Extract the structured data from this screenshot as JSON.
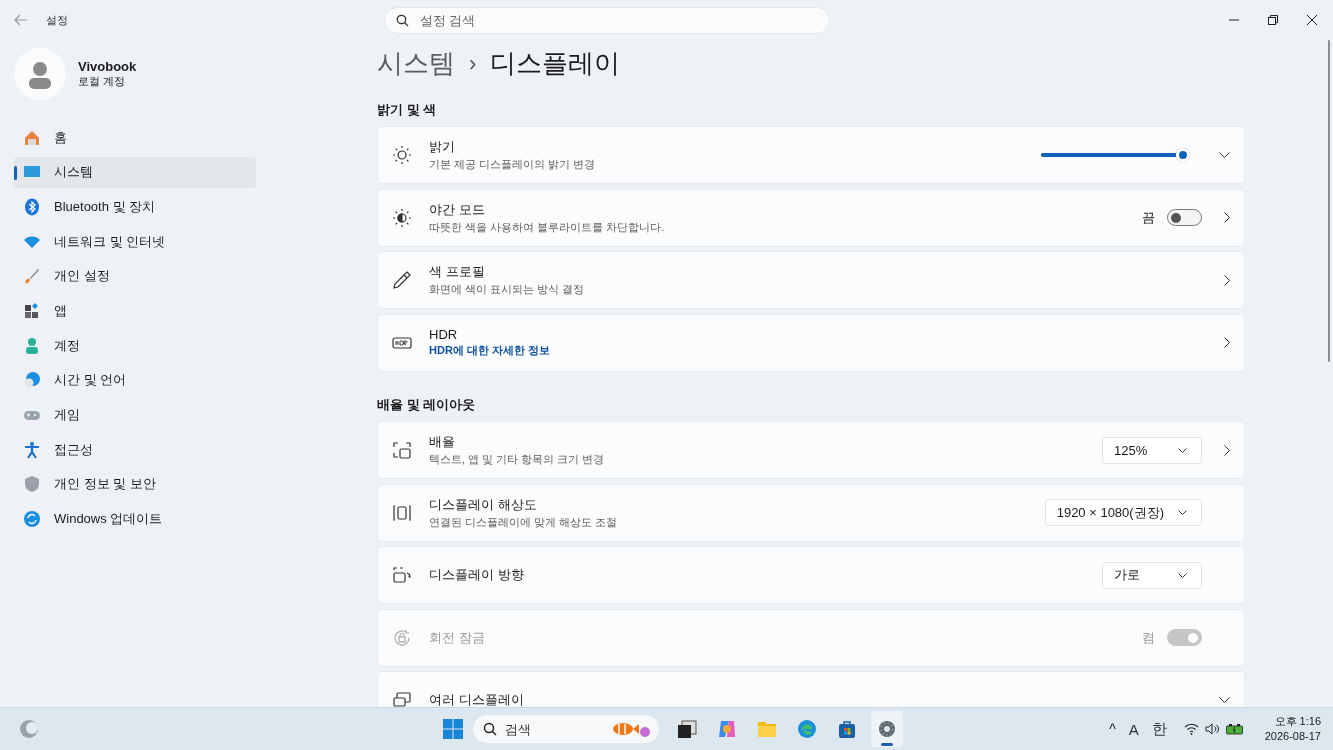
{
  "window": {
    "title": "설정",
    "search": {
      "placeholder": "설정 검색"
    }
  },
  "profile": {
    "name": "Vivobook",
    "account": "로컬 계정"
  },
  "nav": [
    {
      "label": "홈",
      "selected": false
    },
    {
      "label": "시스템",
      "selected": true
    },
    {
      "label": "Bluetooth 및 장치",
      "selected": false
    },
    {
      "label": "네트워크 및 인터넷",
      "selected": false
    },
    {
      "label": "개인 설정",
      "selected": false
    },
    {
      "label": "앱",
      "selected": false
    },
    {
      "label": "계정",
      "selected": false
    },
    {
      "label": "시간 및 언어",
      "selected": false
    },
    {
      "label": "게임",
      "selected": false
    },
    {
      "label": "접근성",
      "selected": false
    },
    {
      "label": "개인 정보 및 보안",
      "selected": false
    },
    {
      "label": "Windows 업데이트",
      "selected": false
    }
  ],
  "breadcrumb": {
    "parent": "시스템",
    "separator": "›",
    "current": "디스플레이"
  },
  "sections": [
    {
      "title": "밝기 및 색",
      "rows": [
        {
          "title": "밝기",
          "subtitle": "기본 제공 디스플레이의 밝기 변경",
          "control": {
            "kind": "slider",
            "level": 0.95
          },
          "disabled": false
        },
        {
          "title": "야간 모드",
          "subtitle": "따뜻한 색을 사용하여 블루라이트를 차단합니다.",
          "control": {
            "kind": "toggle",
            "label": "끔",
            "on": false
          },
          "disabled": false
        },
        {
          "title": "색 프로필",
          "subtitle": "화면에 색이 표시되는 방식 결정",
          "disabled": false
        },
        {
          "title": "HDR",
          "link": "HDR에 대한 자세한 정보",
          "disabled": false
        }
      ]
    },
    {
      "title": "배율 및 레이아웃",
      "rows": [
        {
          "title": "배율",
          "subtitle": "텍스트, 앱 및 기타 항목의 크기 변경",
          "control": {
            "kind": "dropdown",
            "value": "125%"
          },
          "disabled": false
        },
        {
          "title": "디스플레이 해상도",
          "subtitle": "연결된 디스플레이에 맞게 해상도 조절",
          "control": {
            "kind": "dropdown",
            "value": "1920 × 1080(권장)"
          },
          "disabled": false
        },
        {
          "title": "디스플레이 방향",
          "control": {
            "kind": "dropdown",
            "value": "가로"
          },
          "disabled": false
        },
        {
          "title": "회전 잠금",
          "control": {
            "kind": "toggle",
            "label": "켬",
            "on": true
          },
          "disabled": true
        },
        {
          "title": "여러 디스플레이",
          "disabled": false
        }
      ]
    }
  ],
  "taskbar": {
    "search": {
      "placeholder": "검색"
    },
    "apps": [
      {
        "selected": false
      },
      {
        "selected": false
      },
      {
        "selected": false
      },
      {
        "selected": false
      },
      {
        "selected": false
      },
      {
        "selected": true
      }
    ],
    "tray": {
      "chevron": "^",
      "input": "A",
      "ime": "한",
      "time": "오후 1:16",
      "date": "2026-08-17"
    }
  }
}
